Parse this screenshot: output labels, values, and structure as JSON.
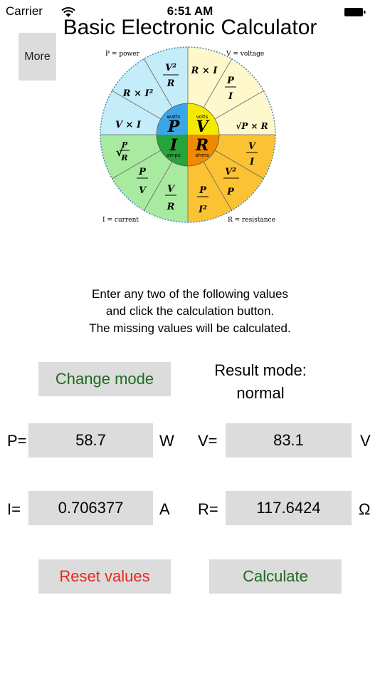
{
  "status_bar": {
    "carrier": "Carrier",
    "time": "6:51 AM"
  },
  "app": {
    "title": "Basic Electronic Calculator"
  },
  "more_button": {
    "label": "More"
  },
  "wheel": {
    "power_caption": "P = power",
    "voltage_caption": "V = voltage",
    "current_caption": "I = current",
    "resistance_caption": "R = resistance",
    "center_p": "P",
    "center_v": "V",
    "center_i": "I",
    "center_r": "R",
    "unit_watts": "watts",
    "unit_volts": "volts",
    "unit_amps": "amps",
    "unit_ohms": "ohms",
    "colors": {
      "power": "#c4ecf9",
      "voltage": "#fff8cc",
      "current": "#a8eaa0",
      "resistance": "#fbc334"
    }
  },
  "instructions": {
    "line1": "Enter any two of the following values",
    "line2": "and click the calculation button.",
    "line3": "The missing values will be calculated."
  },
  "change_mode_button": {
    "label": "Change mode"
  },
  "result_mode": {
    "line1": "Result mode:",
    "line2": "normal"
  },
  "fields": {
    "p": {
      "label": "P=",
      "value": "58.7",
      "unit": "W"
    },
    "v": {
      "label": "V=",
      "value": "83.1",
      "unit": "V"
    },
    "i": {
      "label": "I=",
      "value": "0.706377",
      "unit": "A"
    },
    "r": {
      "label": "R=",
      "value": "117.6424",
      "unit": "Ω"
    }
  },
  "reset_button": {
    "label": "Reset values"
  },
  "calculate_button": {
    "label": "Calculate"
  },
  "colors": {
    "green_text": "#1d6b1d",
    "red_text": "#e8281c",
    "button_bg": "#dcdcdc"
  }
}
